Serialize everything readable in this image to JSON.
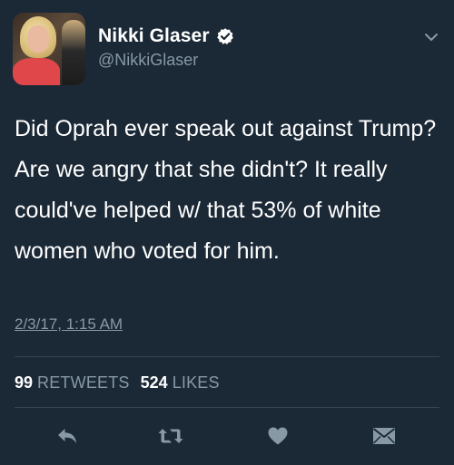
{
  "tweet": {
    "author_name": "Nikki Glaser",
    "handle": "@NikkiGlaser",
    "verified": true,
    "text": "Did Oprah ever speak out against Trump? Are we angry that she didn't? It really could've helped w/ that 53% of white women who voted for him.",
    "timestamp": "2/3/17, 1:15 AM"
  },
  "stats": {
    "retweets_count": "99",
    "retweets_label": "RETWEETS",
    "likes_count": "524",
    "likes_label": "LIKES"
  },
  "icons": {
    "verified": "verified-badge-icon",
    "menu": "chevron-down-icon",
    "reply": "reply-icon",
    "retweet": "retweet-icon",
    "like": "heart-icon",
    "dm": "direct-message-icon"
  },
  "colors": {
    "background": "#1b2836",
    "text_primary": "#ffffff",
    "text_secondary": "#8899a6",
    "divider": "#38444d",
    "icon": "#8899a6"
  }
}
